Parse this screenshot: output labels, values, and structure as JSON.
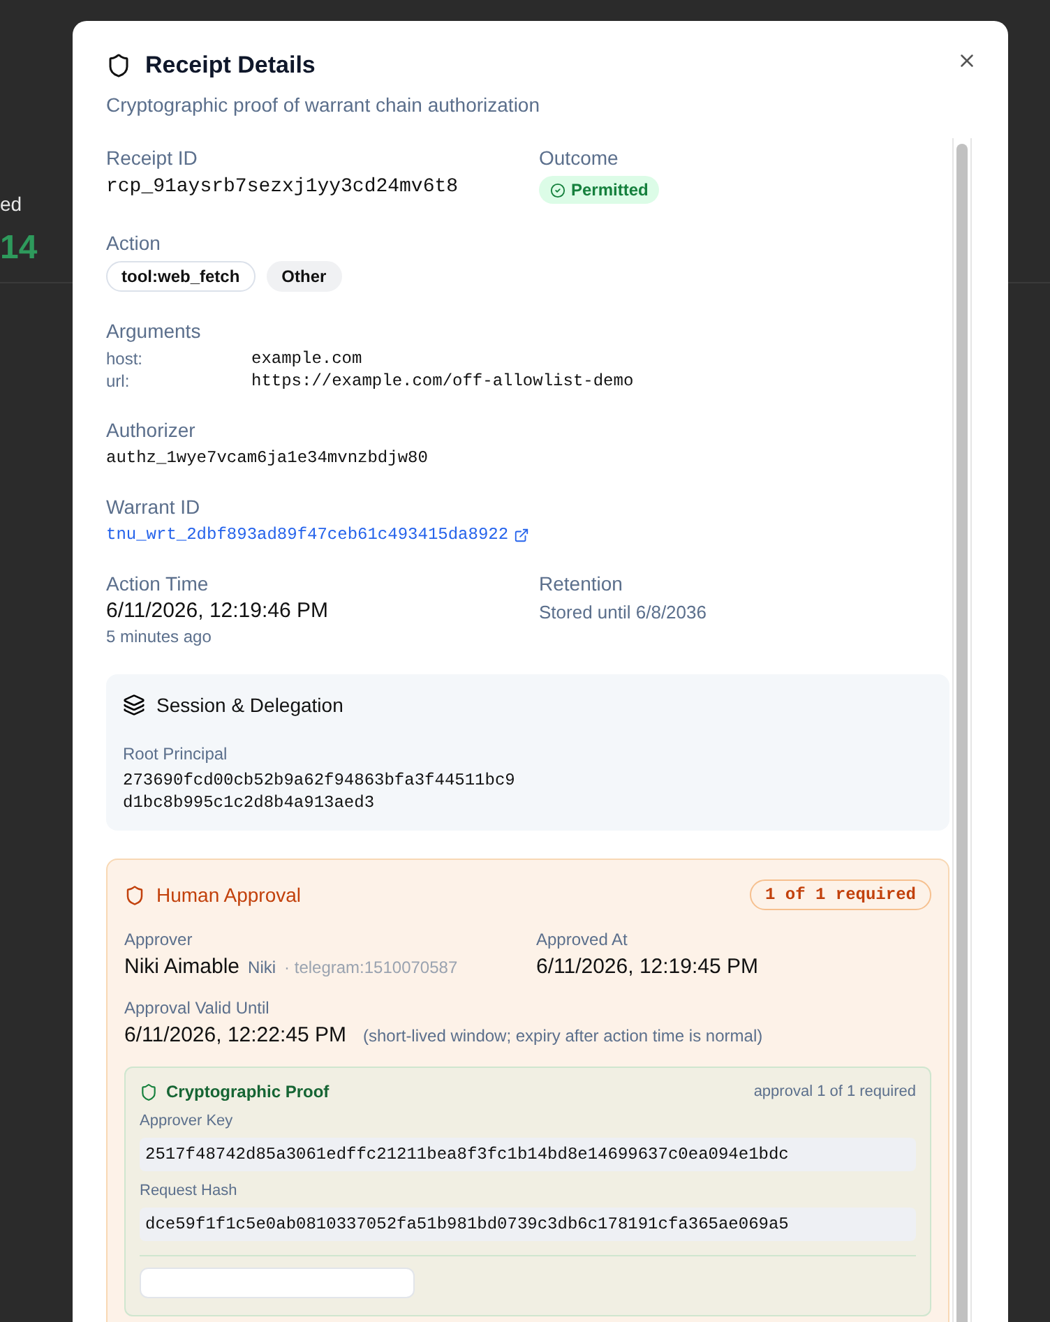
{
  "background": {
    "fragments": [
      {
        "kind": "label",
        "text": "ed"
      },
      {
        "kind": "value",
        "text": "14"
      }
    ]
  },
  "dialog": {
    "title": "Receipt Details",
    "subtitle": "Cryptographic proof of warrant chain authorization",
    "receipt_id": {
      "label": "Receipt ID",
      "value": "rcp_91aysrb7sezxj1yy3cd24mv6t8"
    },
    "outcome": {
      "label": "Outcome",
      "badge": "Permitted"
    },
    "action": {
      "label": "Action",
      "tags": [
        {
          "text": "tool:web_fetch",
          "kind": "outlined"
        },
        {
          "text": "Other",
          "kind": "filled"
        }
      ]
    },
    "arguments": {
      "label": "Arguments",
      "rows": [
        {
          "key": "host:",
          "value": "example.com"
        },
        {
          "key": "url:",
          "value": "https://example.com/off-allowlist-demo"
        }
      ]
    },
    "authorizer": {
      "label": "Authorizer",
      "value": "authz_1wye7vcam6ja1e34mvnzbdjw80"
    },
    "warrant_id": {
      "label": "Warrant ID",
      "value": "tnu_wrt_2dbf893ad89f47ceb61c493415da8922"
    },
    "action_time": {
      "label": "Action Time",
      "value": "6/11/2026, 12:19:46 PM",
      "relative": "5 minutes ago"
    },
    "retention": {
      "label": "Retention",
      "value": "Stored until 6/8/2036"
    },
    "session": {
      "title": "Session & Delegation",
      "root_principal_label": "Root Principal",
      "root_principal": "273690fcd00cb52b9a62f94863bfa3f44511bc9d1bc8b995c1c2d8b4a913aed3"
    },
    "human_approval": {
      "title": "Human Approval",
      "badge": "1 of 1 required",
      "approver_label": "Approver",
      "approver_name": "Niki Aimable",
      "approver_handle": "Niki",
      "approver_source": "· telegram:1510070587",
      "approved_at_label": "Approved At",
      "approved_at": "6/11/2026, 12:19:45 PM",
      "valid_until_label": "Approval Valid Until",
      "valid_until": "6/11/2026, 12:22:45 PM",
      "valid_note": "(short-lived window; expiry after action time is normal)",
      "proof": {
        "title": "Cryptographic Proof",
        "count": "approval 1 of 1 required",
        "fields": [
          {
            "label": "Approver Key",
            "value": "2517f48742d85a3061edffc21211bea8f3fc1b14bd8e14699637c0ea094e1bdc"
          },
          {
            "label": "Request Hash",
            "value": "dce59f1f1c5e0ab0810337052fa51b981bd0739c3db6c178191cfa365ae069a5"
          }
        ]
      }
    }
  }
}
